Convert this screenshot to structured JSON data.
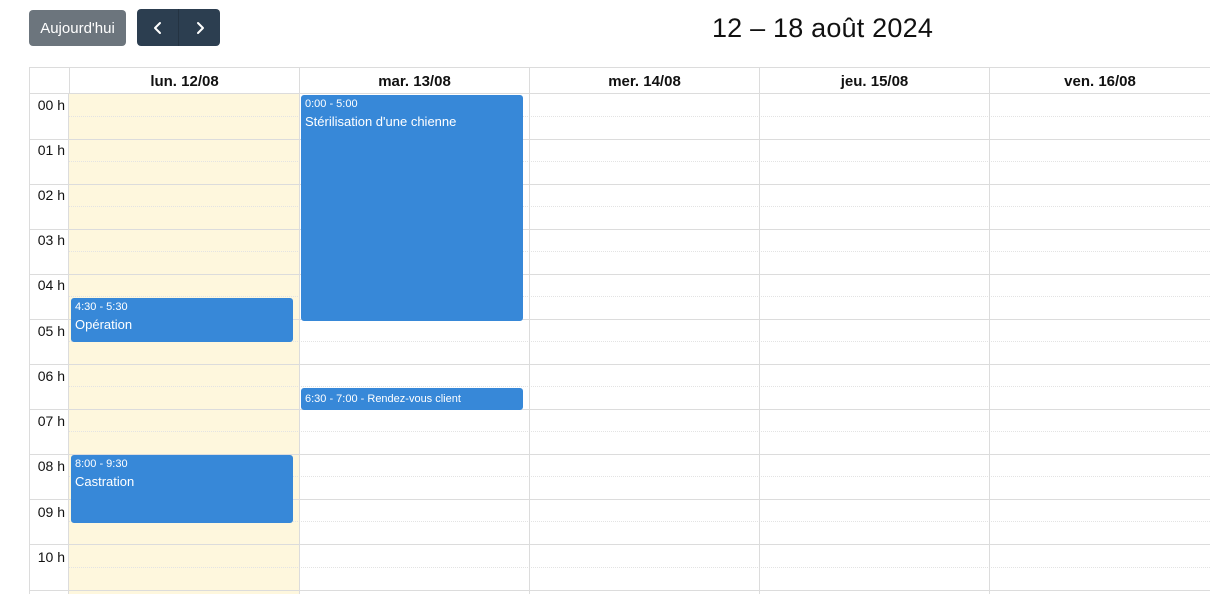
{
  "toolbar": {
    "today_label": "Aujourd'hui",
    "prev_icon": "chevron-left-icon",
    "next_icon": "chevron-right-icon",
    "title": "12 – 18 août 2024"
  },
  "colors": {
    "today_button": "#6c757d",
    "nav_buttons": "#2c3e50",
    "event": "#3788d8",
    "today_highlight": "#fef7dd"
  },
  "days": [
    {
      "label": "lun. 12/08",
      "today": true
    },
    {
      "label": "mar. 13/08"
    },
    {
      "label": "mer. 14/08"
    },
    {
      "label": "jeu. 15/08"
    },
    {
      "label": "ven. 16/08"
    }
  ],
  "hours": [
    "00 h",
    "01 h",
    "02 h",
    "03 h",
    "04 h",
    "05 h",
    "06 h",
    "07 h",
    "08 h",
    "09 h",
    "10 h"
  ],
  "events": [
    {
      "time": "4:30 - 5:30",
      "title": "Opération"
    },
    {
      "time": "8:00 - 9:30",
      "title": "Castration"
    },
    {
      "time": "0:00 - 5:00",
      "title": "Stérilisation d'une chienne"
    },
    {
      "inline": "6:30 - 7:00 - Rendez-vous client"
    }
  ]
}
